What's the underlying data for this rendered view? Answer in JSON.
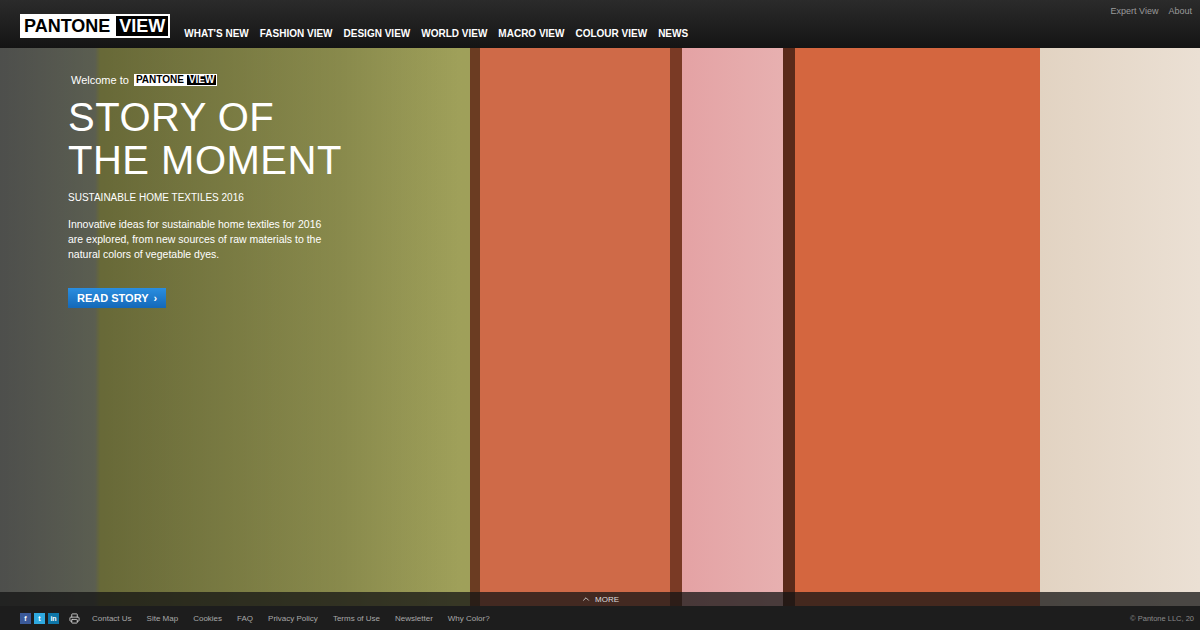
{
  "logo": {
    "left": "PANTONE",
    "right": "VIEW"
  },
  "nav": [
    {
      "label": "WHAT'S NEW"
    },
    {
      "label": "FASHION VIEW"
    },
    {
      "label": "DESIGN VIEW"
    },
    {
      "label": "WORLD VIEW"
    },
    {
      "label": "MACRO VIEW"
    },
    {
      "label": "COLOUR VIEW"
    },
    {
      "label": "NEWS"
    }
  ],
  "utility_links": [
    "Expert View",
    "About"
  ],
  "hero": {
    "welcome": "Welcome to",
    "logo_left": "PANTONE",
    "logo_right": "VIEW",
    "title_lines": [
      "STORY OF",
      "THE MOMENT"
    ],
    "subtitle": "SUSTAINABLE HOME TEXTILES 2016",
    "description": "Innovative ideas for sustainable home textiles for 2016 are explored, from new sources of raw materials to the natural colors of vegetable dyes.",
    "button": "READ STORY",
    "button_arrow": "›"
  },
  "more": {
    "label": "MORE"
  },
  "footer": {
    "social": [
      {
        "label": "f",
        "color": "#3b5998"
      },
      {
        "label": "t",
        "color": "#2fa9e0"
      },
      {
        "label": "in",
        "color": "#0e76a8"
      }
    ],
    "links": [
      "Contact Us",
      "Site Map",
      "Cookies",
      "FAQ",
      "Privacy Policy",
      "Terms of Use",
      "Newsletter",
      "Why Color?"
    ],
    "copyright": "© Pantone LLC, 20"
  }
}
